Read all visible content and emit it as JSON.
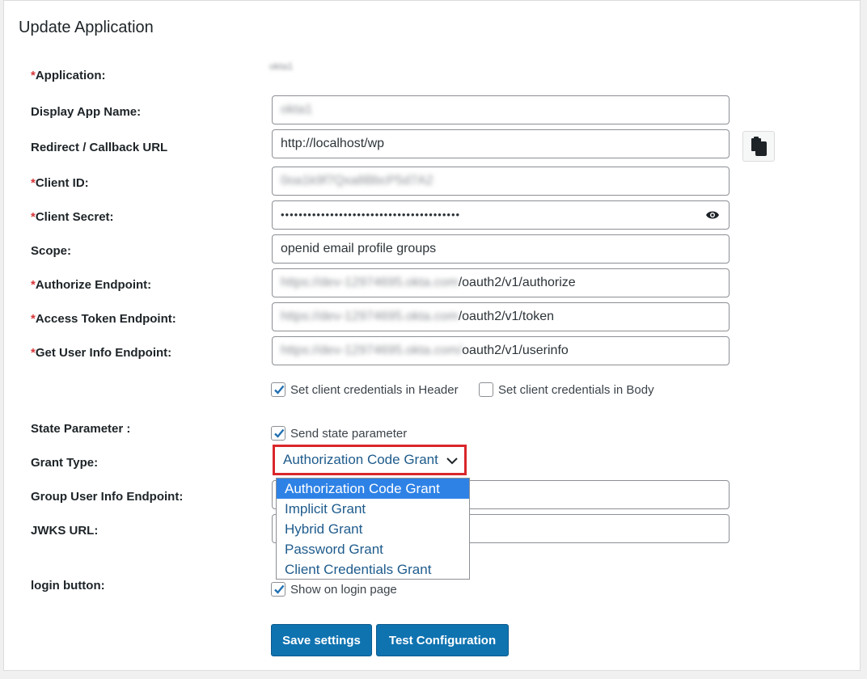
{
  "page": {
    "title": "Update Application"
  },
  "required_mark": "*",
  "fields": {
    "application": {
      "label": "Application:",
      "value": "okta1"
    },
    "display_app_name": {
      "label": "Display App Name:",
      "value": "okta1"
    },
    "redirect_url": {
      "label": "Redirect / Callback URL",
      "value": "http://localhost/wp"
    },
    "client_id": {
      "label": "Client ID:",
      "value": "0oa1k9f7Qxa8BbcP5d7A2"
    },
    "client_secret": {
      "label": "Client Secret:",
      "value": "••••••••••••••••••••••••••••••••••••••••"
    },
    "scope": {
      "label": "Scope:",
      "value": "openid email profile groups"
    },
    "authorize_endpoint": {
      "label": "Authorize Endpoint:",
      "value_hidden": "https://dev-12974695.okta.com",
      "value_visible": "/oauth2/v1/authorize"
    },
    "access_token_endpoint": {
      "label": "Access Token Endpoint:",
      "value_hidden": "https://dev-12974695.okta.com",
      "value_visible": "/oauth2/v1/token"
    },
    "userinfo_endpoint": {
      "label": "Get User Info Endpoint:",
      "value_hidden": "https://dev-12974695.okta.com/",
      "value_visible": "oauth2/v1/userinfo"
    },
    "state_parameter": {
      "label": "State Parameter :"
    },
    "grant_type": {
      "label": "Grant Type:",
      "selected": "Authorization Code Grant"
    },
    "group_userinfo_endpoint": {
      "label": "Group User Info Endpoint:",
      "value": ""
    },
    "jwks_url": {
      "label": "JWKS URL:",
      "value": ""
    },
    "login_button": {
      "label": "login button:"
    }
  },
  "checkboxes": {
    "header": {
      "label": "Set client credentials in Header",
      "checked": true
    },
    "body": {
      "label": "Set client credentials in Body",
      "checked": false
    },
    "state": {
      "label": "Send state parameter",
      "checked": true
    },
    "login_page": {
      "label": "Show on login page",
      "checked": true
    }
  },
  "grant_options": [
    "Authorization Code Grant",
    "Implicit Grant",
    "Hybrid Grant",
    "Password Grant",
    "Client Credentials Grant"
  ],
  "buttons": {
    "save": "Save settings",
    "test": "Test Configuration"
  },
  "icons": {
    "copy": "copy-icon",
    "eye": "eye-icon",
    "chevron": "chevron-down-icon",
    "check": "check-icon"
  },
  "colors": {
    "accent": "#0f73b0",
    "highlight": "#d9262b",
    "option_selected": "#2e82e6",
    "required": "#d63638"
  }
}
